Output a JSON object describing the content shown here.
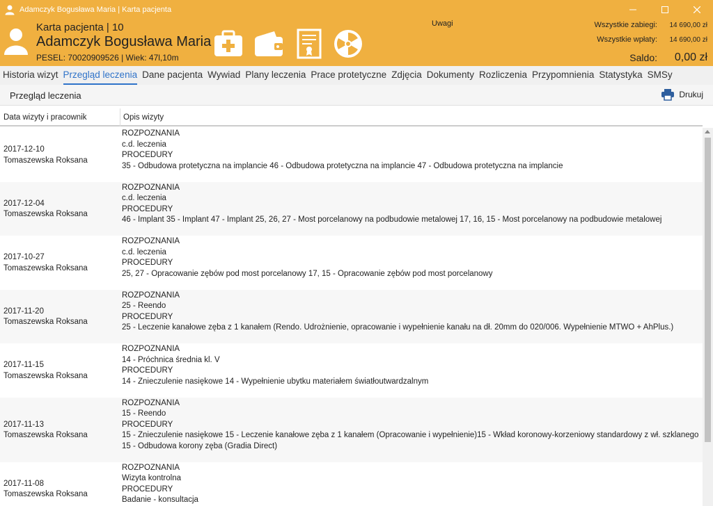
{
  "window": {
    "title": "Adamczyk Bogusława Maria | Karta pacjenta",
    "minimize_icon": "minimize-icon",
    "maximize_icon": "maximize-icon",
    "close_icon": "close-icon"
  },
  "header": {
    "card_title": "Karta pacjenta | 10",
    "patient_name": "Adamczyk Bogusława Maria",
    "pesel_line": "PESEL: 70020909526 | Wiek: 47l,10m",
    "uwagi": "Uwagi",
    "all_procedures_label": "Wszystkie zabiegi:",
    "all_procedures_value": "14 690,00 zł",
    "all_payments_label": "Wszystkie wpłaty:",
    "all_payments_value": "14 690,00 zł",
    "saldo_label": "Saldo:",
    "saldo_value": "0,00 zł",
    "accent_color": "#f0b040"
  },
  "tabs": [
    {
      "label": "Historia wizyt",
      "active": false
    },
    {
      "label": "Przegląd leczenia",
      "active": true
    },
    {
      "label": "Dane pacjenta",
      "active": false
    },
    {
      "label": "Wywiad",
      "active": false
    },
    {
      "label": "Plany leczenia",
      "active": false
    },
    {
      "label": "Prace protetyczne",
      "active": false
    },
    {
      "label": "Zdjęcia",
      "active": false
    },
    {
      "label": "Dokumenty",
      "active": false
    },
    {
      "label": "Rozliczenia",
      "active": false
    },
    {
      "label": "Przypomnienia",
      "active": false
    },
    {
      "label": "Statystyka",
      "active": false
    },
    {
      "label": "SMSy",
      "active": false
    }
  ],
  "toolbar": {
    "section_title": "Przegląd leczenia",
    "print_label": "Drukuj"
  },
  "table": {
    "col_date": "Data wizyty i pracownik",
    "col_desc": "Opis wizyty",
    "rows": [
      {
        "date": "2017-12-10",
        "staff": "Tomaszewska Roksana",
        "lines": [
          "ROZPOZNANIA",
          "c.d. leczenia",
          "PROCEDURY",
          "35 - Odbudowa protetyczna na implancie 46 - Odbudowa protetyczna na implancie 47 - Odbudowa protetyczna na implancie"
        ]
      },
      {
        "date": "2017-12-04",
        "staff": "Tomaszewska Roksana",
        "lines": [
          "ROZPOZNANIA",
          "c.d. leczenia",
          "PROCEDURY",
          "46 - Implant 35 - Implant 47 - Implant 25, 26, 27 - Most porcelanowy na podbudowie metalowej 17, 16, 15 - Most porcelanowy na podbudowie metalowej"
        ]
      },
      {
        "date": "2017-10-27",
        "staff": "Tomaszewska Roksana",
        "lines": [
          "ROZPOZNANIA",
          "c.d. leczenia",
          "PROCEDURY",
          "25, 27 - Opracowanie zębów pod most porcelanowy 17, 15 - Opracowanie zębów pod most porcelanowy"
        ]
      },
      {
        "date": "2017-11-20",
        "staff": "Tomaszewska Roksana",
        "lines": [
          "ROZPOZNANIA",
          "25 - Reendo",
          "PROCEDURY",
          "25 - Leczenie kanałowe zęba z 1 kanałem (Rendo. Udrożnienie, opracowanie i wypełnienie kanału na dł. 20mm do 020/006. Wypełnienie MTWO + AhPlus.)"
        ]
      },
      {
        "date": "2017-11-15",
        "staff": "Tomaszewska Roksana",
        "lines": [
          "ROZPOZNANIA",
          "14 - Próchnica średnia kl. V",
          "PROCEDURY",
          "14 - Znieczulenie nasiękowe 14 - Wypełnienie ubytku materiałem światłoutwardzalnym"
        ]
      },
      {
        "date": "2017-11-13",
        "staff": "Tomaszewska Roksana",
        "lines": [
          "ROZPOZNANIA",
          "15 - Reendo",
          "PROCEDURY",
          "15 - Znieczulenie nasiękowe 15 - Leczenie kanałowe zęba z 1 kanałem (Opracowanie i wypełnienie)15 - Wkład koronowy-korzeniowy standardowy z wł. szklanego",
          "15 - Odbudowa korony zęba (Gradia Direct)"
        ]
      },
      {
        "date": "2017-11-08",
        "staff": "Tomaszewska Roksana",
        "lines": [
          "ROZPOZNANIA",
          "Wizyta kontrolna",
          "PROCEDURY",
          "Badanie - konsultacja"
        ]
      }
    ]
  }
}
